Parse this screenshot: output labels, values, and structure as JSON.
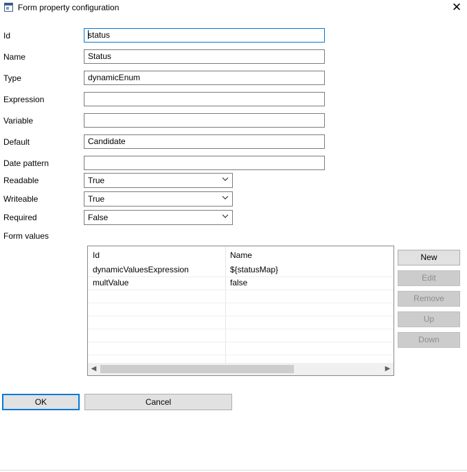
{
  "window": {
    "title": "Form property configuration"
  },
  "fields": {
    "id": {
      "label": "Id",
      "value": "status"
    },
    "name": {
      "label": "Name",
      "value": "Status"
    },
    "type": {
      "label": "Type",
      "value": "dynamicEnum"
    },
    "expression": {
      "label": "Expression",
      "value": ""
    },
    "variable": {
      "label": "Variable",
      "value": ""
    },
    "default": {
      "label": "Default",
      "value": "Candidate"
    },
    "date_pattern": {
      "label": "Date pattern",
      "value": ""
    }
  },
  "selects": {
    "readable": {
      "label": "Readable",
      "value": "True"
    },
    "writeable": {
      "label": "Writeable",
      "value": "True"
    },
    "required": {
      "label": "Required",
      "value": "False"
    }
  },
  "form_values": {
    "label": "Form values",
    "columns": [
      "Id",
      "Name"
    ],
    "rows": [
      [
        "dynamicValuesExpression",
        "${statusMap}"
      ],
      [
        "multValue",
        "false"
      ]
    ]
  },
  "side_buttons": {
    "new": "New",
    "edit": "Edit",
    "remove": "Remove",
    "up": "Up",
    "down": "Down"
  },
  "buttons": {
    "ok": "OK",
    "cancel": "Cancel"
  }
}
